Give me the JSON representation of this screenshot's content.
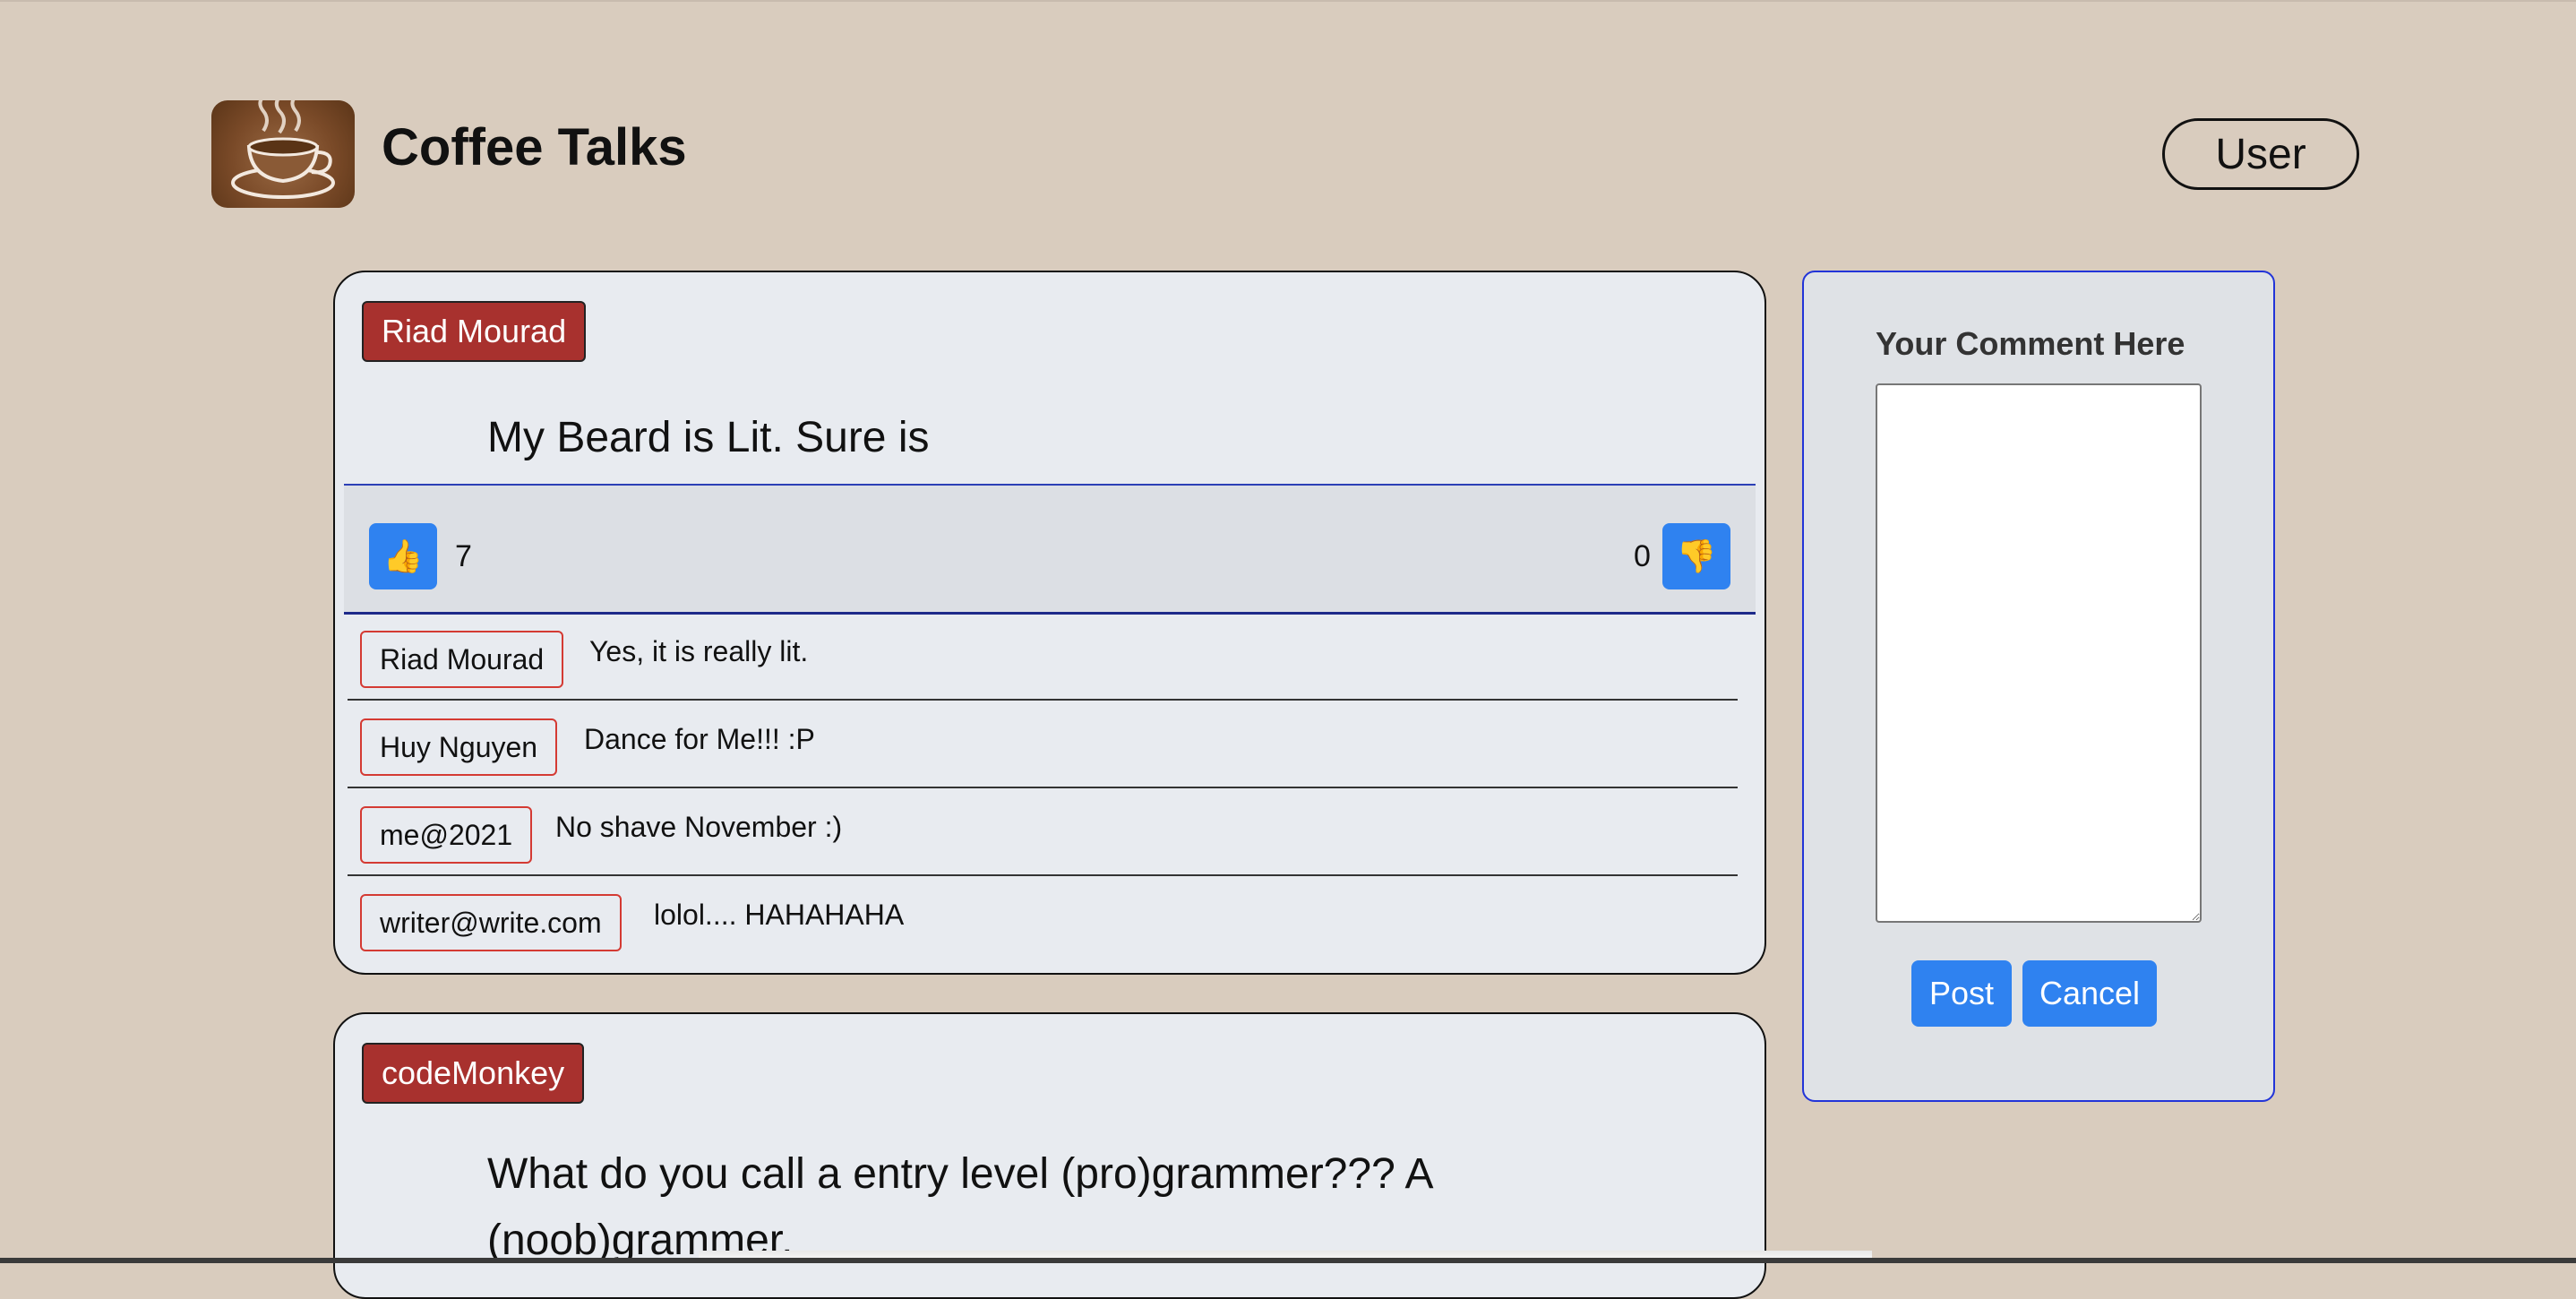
{
  "header": {
    "title": "Coffee Talks",
    "user_button": "User"
  },
  "posts": [
    {
      "author": "Riad Mourad",
      "title": "My Beard is Lit. Sure is",
      "likes": "7",
      "dislikes": "0",
      "like_icon": "thumbs-up-icon",
      "dislike_icon": "thumbs-down-icon",
      "comments": [
        {
          "author": "Riad Mourad",
          "text": "Yes, it is really lit."
        },
        {
          "author": "Huy Nguyen",
          "text": "Dance for Me!!! :P"
        },
        {
          "author": "me@2021",
          "text": "No shave November :)"
        },
        {
          "author": "writer@write.com",
          "text": "lolol.... HAHAHAHA"
        }
      ]
    },
    {
      "author": "codeMonkey",
      "title": "What do you call a entry level (pro)grammer??? A (noob)grammer."
    }
  ],
  "comment_panel": {
    "label": "Your Comment Here",
    "textarea_value": "",
    "post_button": "Post",
    "cancel_button": "Cancel"
  },
  "colors": {
    "background": "#d9ccbe",
    "card": "#e8ebf0",
    "author_badge": "#a8312e",
    "button_blue": "#2f82f0",
    "panel_border": "#2234d8"
  }
}
